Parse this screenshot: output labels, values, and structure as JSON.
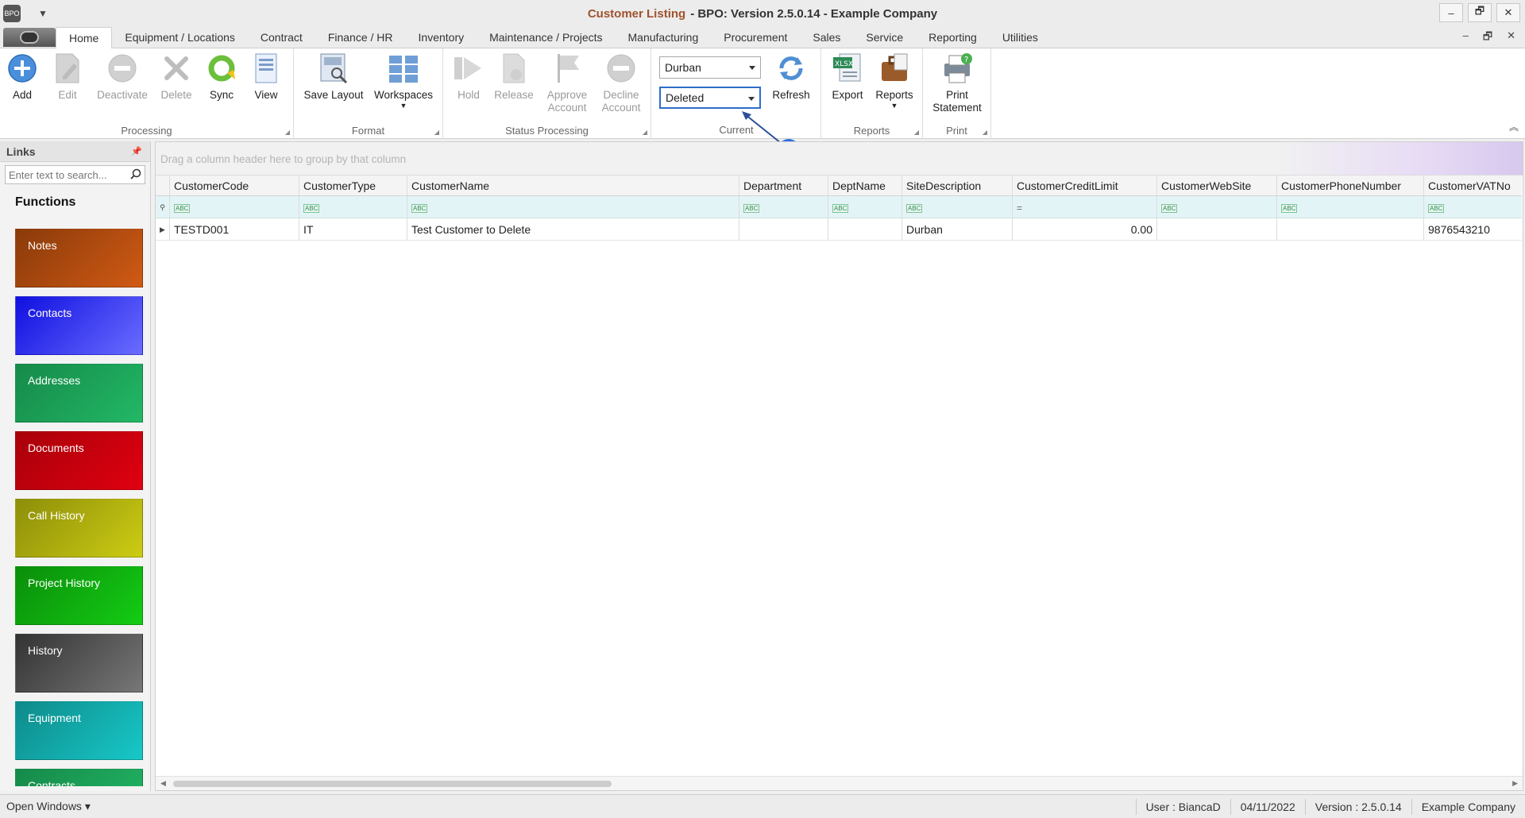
{
  "window": {
    "title_part1": "Customer Listing",
    "title_part2": "- BPO: Version 2.5.0.14 - Example Company",
    "controls": [
      "–",
      "🗗",
      "✕"
    ]
  },
  "ribbon_tabs": [
    "Home",
    "Equipment / Locations",
    "Contract",
    "Finance / HR",
    "Inventory",
    "Maintenance / Projects",
    "Manufacturing",
    "Procurement",
    "Sales",
    "Service",
    "Reporting",
    "Utilities"
  ],
  "ribbon": {
    "processing": {
      "label": "Processing",
      "add": "Add",
      "edit": "Edit",
      "deactivate": "Deactivate",
      "delete": "Delete",
      "sync": "Sync",
      "view": "View"
    },
    "format": {
      "label": "Format",
      "save_layout": "Save Layout",
      "workspaces": "Workspaces"
    },
    "status_processing": {
      "label": "Status Processing",
      "hold": "Hold",
      "release": "Release",
      "approve_1": "Approve",
      "approve_2": "Account",
      "decline_1": "Decline",
      "decline_2": "Account"
    },
    "current": {
      "label": "Current",
      "site_value": "Durban",
      "status_value": "Deleted",
      "refresh": "Refresh"
    },
    "reports": {
      "label": "Reports",
      "export": "Export",
      "reports": "Reports"
    },
    "print": {
      "label": "Print",
      "print_1": "Print",
      "print_2": "Statement"
    }
  },
  "links": {
    "title": "Links",
    "search_placeholder": "Enter text to search...",
    "functions_title": "Functions",
    "items": [
      {
        "label": "Notes",
        "color": "#b84a0e"
      },
      {
        "label": "Contacts",
        "color": "#2f3cf5"
      },
      {
        "label": "Addresses",
        "color": "#1ea65a"
      },
      {
        "label": "Documents",
        "color": "#c8000c"
      },
      {
        "label": "Call History",
        "color": "#b5b50e"
      },
      {
        "label": "Project History",
        "color": "#0fb60f"
      },
      {
        "label": "History",
        "color": "#555555"
      },
      {
        "label": "Equipment",
        "color": "#12b2b2"
      },
      {
        "label": "Contracts",
        "color": "#1ea65a"
      }
    ]
  },
  "grid": {
    "group_hint": "Drag a column header here to group by that column",
    "columns": [
      "CustomerCode",
      "CustomerType",
      "CustomerName",
      "Department",
      "DeptName",
      "SiteDescription",
      "CustomerCreditLimit",
      "CustomerWebSite",
      "CustomerPhoneNumber",
      "CustomerVATNo"
    ],
    "rows": [
      [
        "TESTD001",
        "IT",
        "Test Customer to Delete",
        "",
        "",
        "Durban",
        "0.00",
        "",
        "",
        "9876543210"
      ]
    ]
  },
  "status": {
    "open_windows": "Open Windows ▾",
    "user": "User : BiancaD",
    "date": "04/11/2022",
    "version": "Version : 2.5.0.14",
    "company": "Example Company"
  }
}
